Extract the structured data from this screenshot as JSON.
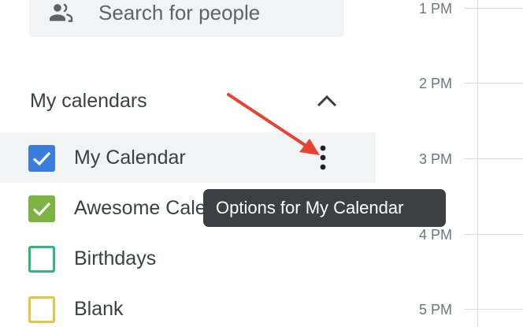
{
  "search": {
    "placeholder": "Search for people",
    "icon": "people-icon"
  },
  "my_calendars": {
    "title": "My calendars",
    "expanded": true,
    "items": [
      {
        "label": "My Calendar",
        "checked": true,
        "color": "#3b7ddd"
      },
      {
        "label": "Awesome Calendar",
        "checked": true,
        "color": "#7cb342"
      },
      {
        "label": "Birthdays",
        "checked": false,
        "color": "#33b679"
      },
      {
        "label": "Blank",
        "checked": false,
        "color": "#e4c441"
      }
    ]
  },
  "tooltip": {
    "text": "Options for My Calendar"
  },
  "timeline": {
    "hours": [
      "1 PM",
      "2 PM",
      "3 PM",
      "4 PM",
      "5 PM"
    ]
  },
  "colors": {
    "annotation_arrow": "#e8432f",
    "tooltip_bg": "#3c4043",
    "hover_bg": "#f1f3f4"
  }
}
